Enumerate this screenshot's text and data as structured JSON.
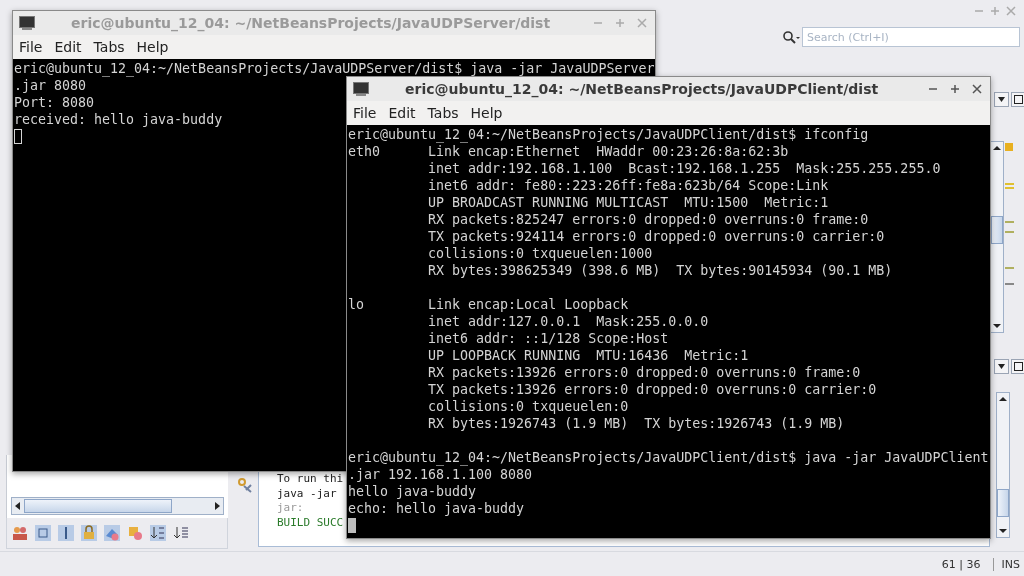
{
  "ide": {
    "search": {
      "placeholder": "Search (Ctrl+I)"
    },
    "output_lines": [
      {
        "text": "To run thi",
        "kind": "plain"
      },
      {
        "text": "java -jar",
        "kind": "plain"
      },
      {
        "text": "jar:",
        "kind": "muted"
      },
      {
        "text": "BUILD SUCC",
        "kind": "success"
      }
    ],
    "status_bar": {
      "position": "61 | 36",
      "mode": "INS"
    }
  },
  "terminals": [
    {
      "title": "eric@ubuntu_12_04: ~/NetBeansProjects/JavaUDPServer/dist",
      "focused": false,
      "menu": [
        "File",
        "Edit",
        "Tabs",
        "Help"
      ],
      "output_blocks": [
        [
          "eric@ubuntu_12_04:~/NetBeansProjects/JavaUDPServer/dist$ java -jar JavaUDPServer",
          ".jar 8080",
          "Port: 8080",
          "received: hello java-buddy"
        ]
      ]
    },
    {
      "title": "eric@ubuntu_12_04: ~/NetBeansProjects/JavaUDPClient/dist",
      "focused": true,
      "menu": [
        "File",
        "Edit",
        "Tabs",
        "Help"
      ],
      "output_blocks": [
        [
          "eric@ubuntu_12_04:~/NetBeansProjects/JavaUDPClient/dist$ ifconfig",
          "eth0      Link encap:Ethernet  HWaddr 00:23:26:8a:62:3b",
          "          inet addr:192.168.1.100  Bcast:192.168.1.255  Mask:255.255.255.0",
          "          inet6 addr: fe80::223:26ff:fe8a:623b/64 Scope:Link",
          "          UP BROADCAST RUNNING MULTICAST  MTU:1500  Metric:1",
          "          RX packets:825247 errors:0 dropped:0 overruns:0 frame:0",
          "          TX packets:924114 errors:0 dropped:0 overruns:0 carrier:0",
          "          collisions:0 txqueuelen:1000",
          "          RX bytes:398625349 (398.6 MB)  TX bytes:90145934 (90.1 MB)"
        ],
        [
          "lo        Link encap:Local Loopback",
          "          inet addr:127.0.0.1  Mask:255.0.0.0",
          "          inet6 addr: ::1/128 Scope:Host",
          "          UP LOOPBACK RUNNING  MTU:16436  Metric:1",
          "          RX packets:13926 errors:0 dropped:0 overruns:0 frame:0",
          "          TX packets:13926 errors:0 dropped:0 overruns:0 carrier:0",
          "          collisions:0 txqueuelen:0",
          "          RX bytes:1926743 (1.9 MB)  TX bytes:1926743 (1.9 MB)"
        ],
        [
          "eric@ubuntu_12_04:~/NetBeansProjects/JavaUDPClient/dist$ java -jar JavaUDPClient",
          ".jar 192.168.1.100 8080",
          "hello java-buddy",
          "echo: hello java-buddy"
        ]
      ]
    }
  ]
}
